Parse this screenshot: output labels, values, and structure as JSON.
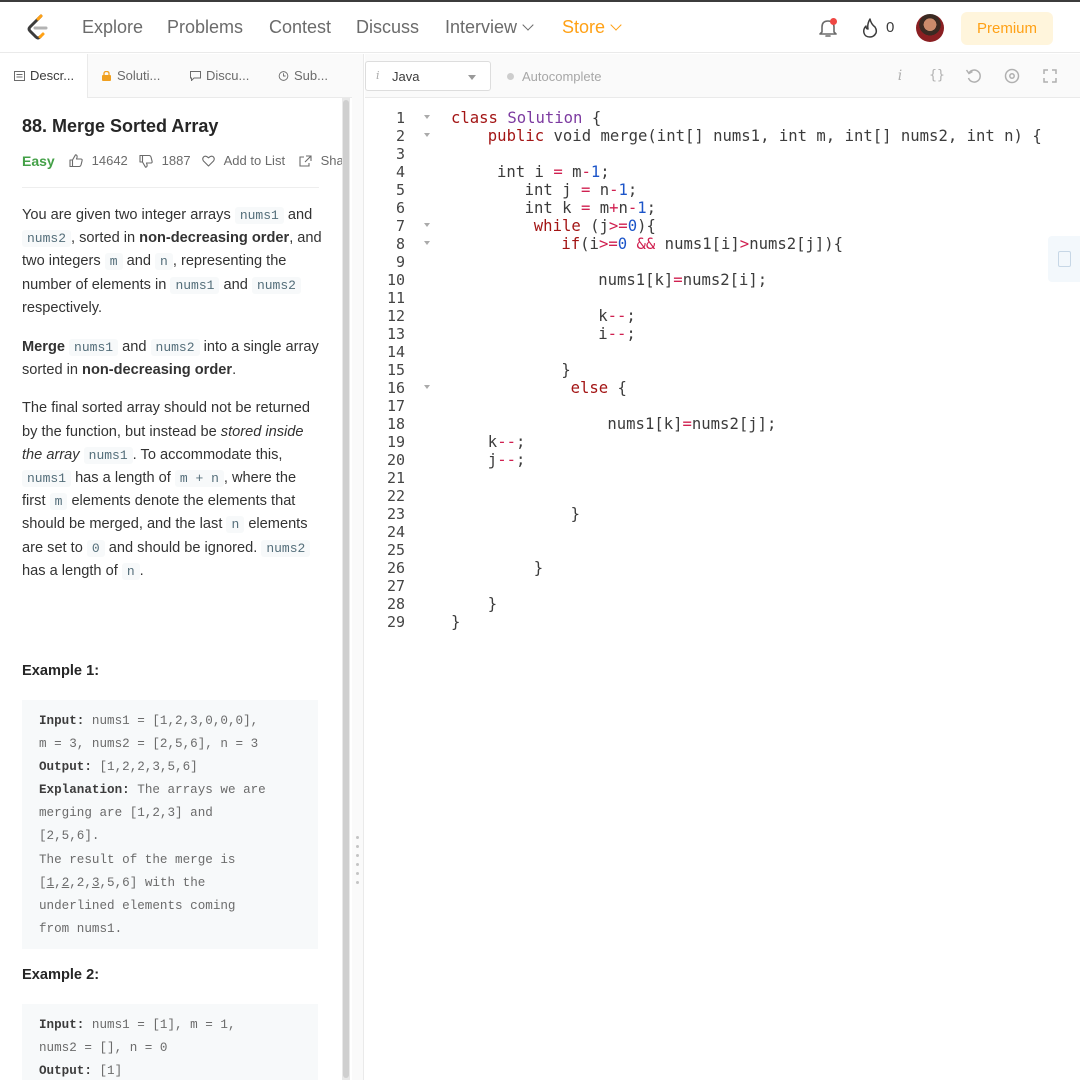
{
  "nav": {
    "links": [
      "Explore",
      "Problems",
      "Contest",
      "Discuss",
      "Interview",
      "Store"
    ],
    "fire_count": "0",
    "premium_label": "Premium"
  },
  "tabs": [
    "Descr...",
    "Soluti...",
    "Discu...",
    "Sub..."
  ],
  "problem": {
    "title": "88. Merge Sorted Array",
    "difficulty": "Easy",
    "likes": "14642",
    "dislikes": "1887",
    "add_to_list": "Add to List",
    "share": "Sha"
  },
  "description": {
    "p1": [
      {
        "t": "text",
        "v": "You are given two integer arrays "
      },
      {
        "t": "code",
        "v": "nums1"
      },
      {
        "t": "text",
        "v": " and "
      },
      {
        "t": "code",
        "v": "nums2"
      },
      {
        "t": "text",
        "v": ", sorted in "
      },
      {
        "t": "bold",
        "v": "non-decreasing order"
      },
      {
        "t": "text",
        "v": ", and two integers "
      },
      {
        "t": "code",
        "v": "m"
      },
      {
        "t": "text",
        "v": " and "
      },
      {
        "t": "code",
        "v": "n"
      },
      {
        "t": "text",
        "v": ", representing the number of elements in "
      },
      {
        "t": "code",
        "v": "nums1"
      },
      {
        "t": "text",
        "v": " and "
      },
      {
        "t": "code",
        "v": "nums2"
      },
      {
        "t": "text",
        "v": " respectively."
      }
    ],
    "p2": [
      {
        "t": "bold",
        "v": "Merge"
      },
      {
        "t": "text",
        "v": " "
      },
      {
        "t": "code",
        "v": "nums1"
      },
      {
        "t": "text",
        "v": " and "
      },
      {
        "t": "code",
        "v": "nums2"
      },
      {
        "t": "text",
        "v": " into a single array sorted in "
      },
      {
        "t": "bold",
        "v": "non-decreasing order"
      },
      {
        "t": "text",
        "v": "."
      }
    ],
    "p3": [
      {
        "t": "text",
        "v": "The final sorted array should not be returned by the function, but instead be "
      },
      {
        "t": "em",
        "v": "stored inside the array"
      },
      {
        "t": "text",
        "v": " "
      },
      {
        "t": "code",
        "v": "nums1"
      },
      {
        "t": "text",
        "v": ". To accommodate this, "
      },
      {
        "t": "code",
        "v": "nums1"
      },
      {
        "t": "text",
        "v": " has a length of "
      },
      {
        "t": "code",
        "v": "m + n"
      },
      {
        "t": "text",
        "v": ", where the first "
      },
      {
        "t": "code",
        "v": "m"
      },
      {
        "t": "text",
        "v": " elements denote the elements that should be merged, and the last "
      },
      {
        "t": "code",
        "v": "n"
      },
      {
        "t": "text",
        "v": " elements are set to "
      },
      {
        "t": "code",
        "v": "0"
      },
      {
        "t": "text",
        "v": " and should be ignored. "
      },
      {
        "t": "code",
        "v": "nums2"
      },
      {
        "t": "text",
        "v": " has a length of "
      },
      {
        "t": "code",
        "v": "n"
      },
      {
        "t": "text",
        "v": "."
      }
    ]
  },
  "examples": [
    {
      "heading": "Example 1:",
      "lines": [
        [
          {
            "t": "b",
            "v": "Input:"
          },
          {
            "t": "t",
            "v": " nums1 = [1,2,3,0,0,0],"
          }
        ],
        [
          {
            "t": "t",
            "v": "m = 3, nums2 = [2,5,6], n = 3"
          }
        ],
        [
          {
            "t": "b",
            "v": "Output:"
          },
          {
            "t": "t",
            "v": " [1,2,2,3,5,6]"
          }
        ],
        [
          {
            "t": "b",
            "v": "Explanation:"
          },
          {
            "t": "t",
            "v": " The arrays we are"
          }
        ],
        [
          {
            "t": "t",
            "v": "merging are [1,2,3] and"
          }
        ],
        [
          {
            "t": "t",
            "v": "[2,5,6]."
          }
        ],
        [
          {
            "t": "t",
            "v": "The result of the merge is"
          }
        ],
        [
          {
            "t": "t",
            "v": "["
          },
          {
            "t": "u",
            "v": "1"
          },
          {
            "t": "t",
            "v": ","
          },
          {
            "t": "u",
            "v": "2"
          },
          {
            "t": "t",
            "v": ",2,"
          },
          {
            "t": "u",
            "v": "3"
          },
          {
            "t": "t",
            "v": ",5,6] with the"
          }
        ],
        [
          {
            "t": "t",
            "v": "underlined elements coming"
          }
        ],
        [
          {
            "t": "t",
            "v": "from nums1."
          }
        ]
      ]
    },
    {
      "heading": "Example 2:",
      "lines": [
        [
          {
            "t": "b",
            "v": "Input:"
          },
          {
            "t": "t",
            "v": " nums1 = [1], m = 1,"
          }
        ],
        [
          {
            "t": "t",
            "v": "nums2 = [], n = 0"
          }
        ],
        [
          {
            "t": "b",
            "v": "Output:"
          },
          {
            "t": "t",
            "v": " [1]"
          }
        ]
      ]
    }
  ],
  "editor": {
    "language": "Java",
    "autocomplete_label": "Autocomplete",
    "lines": [
      {
        "indent": 0,
        "fold": true,
        "tokens": [
          [
            "kw",
            "class"
          ],
          [
            "p",
            " "
          ],
          [
            "cls",
            "Solution"
          ],
          [
            "p",
            " {"
          ]
        ]
      },
      {
        "indent": 4,
        "fold": true,
        "tokens": [
          [
            "kw",
            "public"
          ],
          [
            "p",
            " void merge(int[] nums1, int m, int[] nums2, int n) {"
          ]
        ]
      },
      {
        "indent": 0,
        "fold": false,
        "tokens": []
      },
      {
        "indent": 5,
        "fold": false,
        "tokens": [
          [
            "p",
            "int i "
          ],
          [
            "op",
            "="
          ],
          [
            "p",
            " m"
          ],
          [
            "op",
            "-"
          ],
          [
            "num",
            "1"
          ],
          [
            "p",
            ";"
          ]
        ]
      },
      {
        "indent": 8,
        "fold": false,
        "tokens": [
          [
            "p",
            "int j "
          ],
          [
            "op",
            "="
          ],
          [
            "p",
            " n"
          ],
          [
            "op",
            "-"
          ],
          [
            "num",
            "1"
          ],
          [
            "p",
            ";"
          ]
        ]
      },
      {
        "indent": 8,
        "fold": false,
        "tokens": [
          [
            "p",
            "int k "
          ],
          [
            "op",
            "="
          ],
          [
            "p",
            " m"
          ],
          [
            "op",
            "+"
          ],
          [
            "p",
            "n"
          ],
          [
            "op",
            "-"
          ],
          [
            "num",
            "1"
          ],
          [
            "p",
            ";"
          ]
        ]
      },
      {
        "indent": 9,
        "fold": true,
        "tokens": [
          [
            "kw",
            "while"
          ],
          [
            "p",
            " (j"
          ],
          [
            "op",
            ">="
          ],
          [
            "num",
            "0"
          ],
          [
            "p",
            "){"
          ]
        ]
      },
      {
        "indent": 12,
        "fold": true,
        "tokens": [
          [
            "kw",
            "if"
          ],
          [
            "p",
            "(i"
          ],
          [
            "op",
            ">="
          ],
          [
            "num",
            "0"
          ],
          [
            "p",
            " "
          ],
          [
            "op",
            "&&"
          ],
          [
            "p",
            " nums1[i]"
          ],
          [
            "op",
            ">"
          ],
          [
            "p",
            "nums2[j]){"
          ]
        ]
      },
      {
        "indent": 0,
        "fold": false,
        "tokens": []
      },
      {
        "indent": 16,
        "fold": false,
        "tokens": [
          [
            "p",
            "nums1[k]"
          ],
          [
            "op",
            "="
          ],
          [
            "p",
            "nums2[i];"
          ]
        ]
      },
      {
        "indent": 0,
        "fold": false,
        "tokens": []
      },
      {
        "indent": 16,
        "fold": false,
        "tokens": [
          [
            "p",
            "k"
          ],
          [
            "op",
            "--"
          ],
          [
            "p",
            ";"
          ]
        ]
      },
      {
        "indent": 16,
        "fold": false,
        "tokens": [
          [
            "p",
            "i"
          ],
          [
            "op",
            "--"
          ],
          [
            "p",
            ";"
          ]
        ]
      },
      {
        "indent": 0,
        "fold": false,
        "tokens": []
      },
      {
        "indent": 12,
        "fold": false,
        "tokens": [
          [
            "p",
            "}"
          ]
        ]
      },
      {
        "indent": 13,
        "fold": true,
        "tokens": [
          [
            "kw",
            "else"
          ],
          [
            "p",
            " {"
          ]
        ]
      },
      {
        "indent": 0,
        "fold": false,
        "tokens": []
      },
      {
        "indent": 17,
        "fold": false,
        "tokens": [
          [
            "p",
            "nums1[k]"
          ],
          [
            "op",
            "="
          ],
          [
            "p",
            "nums2[j];"
          ]
        ]
      },
      {
        "indent": 4,
        "fold": false,
        "tokens": [
          [
            "p",
            "k"
          ],
          [
            "op",
            "--"
          ],
          [
            "p",
            ";"
          ]
        ]
      },
      {
        "indent": 4,
        "fold": false,
        "tokens": [
          [
            "p",
            "j"
          ],
          [
            "op",
            "--"
          ],
          [
            "p",
            ";"
          ]
        ]
      },
      {
        "indent": 0,
        "fold": false,
        "tokens": []
      },
      {
        "indent": 0,
        "fold": false,
        "tokens": []
      },
      {
        "indent": 13,
        "fold": false,
        "tokens": [
          [
            "p",
            "}"
          ]
        ]
      },
      {
        "indent": 0,
        "fold": false,
        "tokens": []
      },
      {
        "indent": 0,
        "fold": false,
        "tokens": []
      },
      {
        "indent": 9,
        "fold": false,
        "tokens": [
          [
            "p",
            "}"
          ]
        ]
      },
      {
        "indent": 0,
        "fold": false,
        "tokens": []
      },
      {
        "indent": 4,
        "fold": false,
        "tokens": [
          [
            "p",
            "}"
          ]
        ]
      },
      {
        "indent": 0,
        "fold": false,
        "tokens": [
          [
            "p",
            "}"
          ]
        ]
      }
    ]
  },
  "colors": {
    "accent": "#ffa116",
    "easy": "#43a047",
    "keyword": "#a31515",
    "class_name": "#7c3aa0",
    "number": "#1c55c9",
    "operator": "#d02050"
  }
}
